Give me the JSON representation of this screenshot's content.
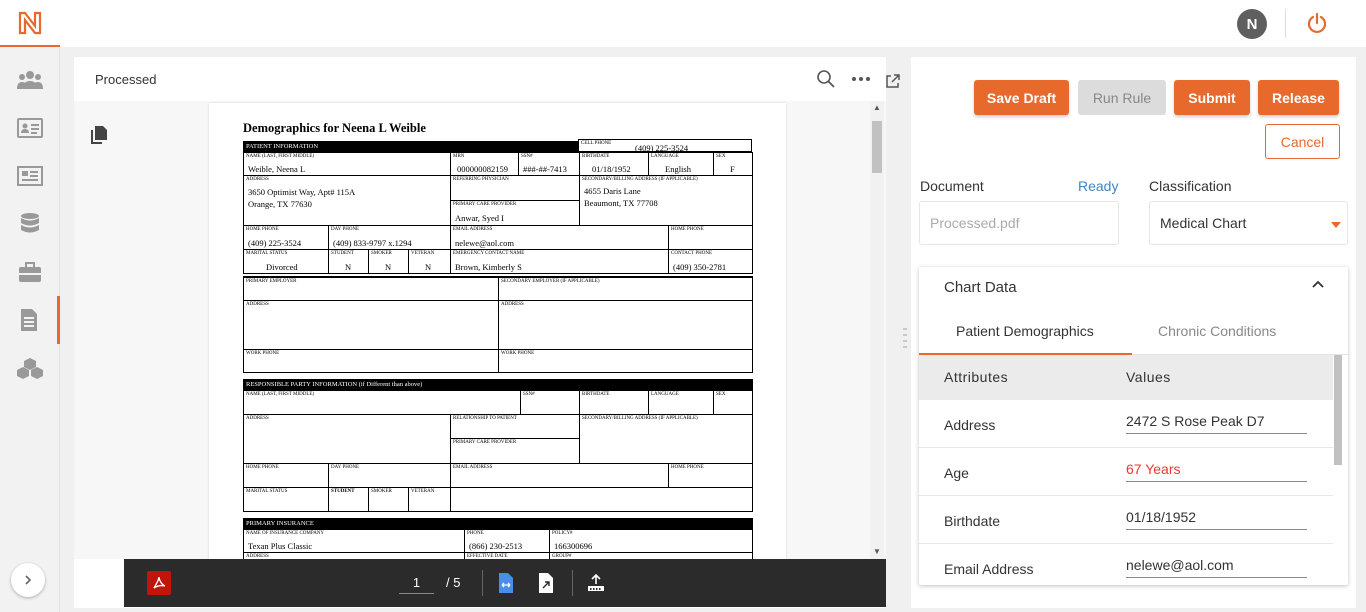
{
  "header": {
    "avatar_initial": "N"
  },
  "nav": {
    "items": [
      "people-icon",
      "id-card-icon",
      "news-icon",
      "database-icon",
      "briefcase-icon",
      "document-icon",
      "cubes-icon"
    ],
    "active_index": 5
  },
  "document": {
    "title": "Processed",
    "pdf": {
      "heading": "Demographics for Neena L Weible",
      "patient_info_bar": "PATIENT INFORMATION",
      "cell_phone_label": "CELL PHONE",
      "cell_phone": "(409) 225-3524",
      "name_label": "NAME (Last, First Middle)",
      "name": "Weible, Neena L",
      "mrn_label": "MRN",
      "mrn": "000000082159",
      "ssn_label": "SSN#",
      "ssn": "###-##-7413",
      "birthdate_label": "BIRTHDATE",
      "birthdate": "01/18/1952",
      "language_label": "LANGUAGE",
      "language": "English",
      "sex_label": "SEX",
      "sex": "F",
      "address_label": "ADDRESS",
      "address_line1": "3650 Optimist Way, Apt# 115A",
      "address_line2": "Orange, TX  77630",
      "referring_label": "REFERRING PHYSICIAN",
      "pcp_label": "PRIMARY CARE PROVIDER",
      "pcp": "Anwar, Syed I",
      "secondary_addr_label": "SECONDARY/BILLING ADDRESS (if Applicable)",
      "secondary_addr1": "4655 Daris Lane",
      "secondary_addr2": "Beaumont, TX   77708",
      "home_phone_label": "HOME PHONE",
      "home_phone": "(409) 225-3524",
      "day_phone_label": "DAY PHONE",
      "day_phone": "(409) 833-9797 x.1294",
      "email_label": "EMAIL ADDRESS",
      "email": "nelewe@aol.com",
      "home_phone2_label": "HOME PHONE",
      "marital_label": "MARITAL STATUS",
      "marital": "Divorced",
      "student_label": "STUDENT",
      "student": "N",
      "smoker_label": "SMOKER",
      "smoker": "N",
      "veteran_label": "VETERAN",
      "veteran": "N",
      "emergency_label": "EMERGENCY CONTACT NAME",
      "emergency": "Brown, Kimberly S",
      "contact_phone_label": "CONTACT PHONE",
      "contact_phone": "(409) 350-2781",
      "primary_employer_label": "PRIMARY EMPLOYER",
      "secondary_employer_label": "SECONDARY EMPLOYER (if Applicable)",
      "work_phone_label": "WORK PHONE",
      "responsible_bar": "RESPONSIBLE PARTY INFORMATION (if Different than above)",
      "relationship_label": "RELATIONSHIP TO PATIENT",
      "primary_insurance_bar": "PRIMARY INSURANCE",
      "insurance_company_label": "NAME OF INSURANCE COMPANY",
      "insurance_company": "Texan Plus Classic",
      "phone_label": "PHONE",
      "insurance_phone": "(866) 230-2513",
      "policy_label": "POLICY#",
      "policy": "166300696",
      "effective_label": "EFFECTIVE DATE",
      "group_label": "GROUP#"
    },
    "current_page": "1",
    "total_pages": "/ 5"
  },
  "actions": {
    "save_draft": "Save Draft",
    "run_rule": "Run Rule",
    "submit": "Submit",
    "release": "Release",
    "cancel": "Cancel"
  },
  "fields": {
    "document_label": "Document",
    "document_status": "Ready",
    "document_value": "Processed.pdf",
    "classification_label": "Classification",
    "classification_value": "Medical Chart"
  },
  "chart_card": {
    "title": "Chart Data",
    "tabs": [
      "Patient Demographics",
      "Chronic Conditions"
    ],
    "columns": [
      "Attributes",
      "Values"
    ],
    "rows": [
      {
        "attribute": "Address",
        "value": "2472 S Rose Peak D7"
      },
      {
        "attribute": "Age",
        "value": "67 Years"
      },
      {
        "attribute": "Birthdate",
        "value": "01/18/1952"
      },
      {
        "attribute": "Email Address",
        "value": "nelewe@aol.com"
      }
    ]
  },
  "colors": {
    "accent": "#e8692c",
    "status_ready": "#3d85c6",
    "warning_value": "#e53935"
  }
}
